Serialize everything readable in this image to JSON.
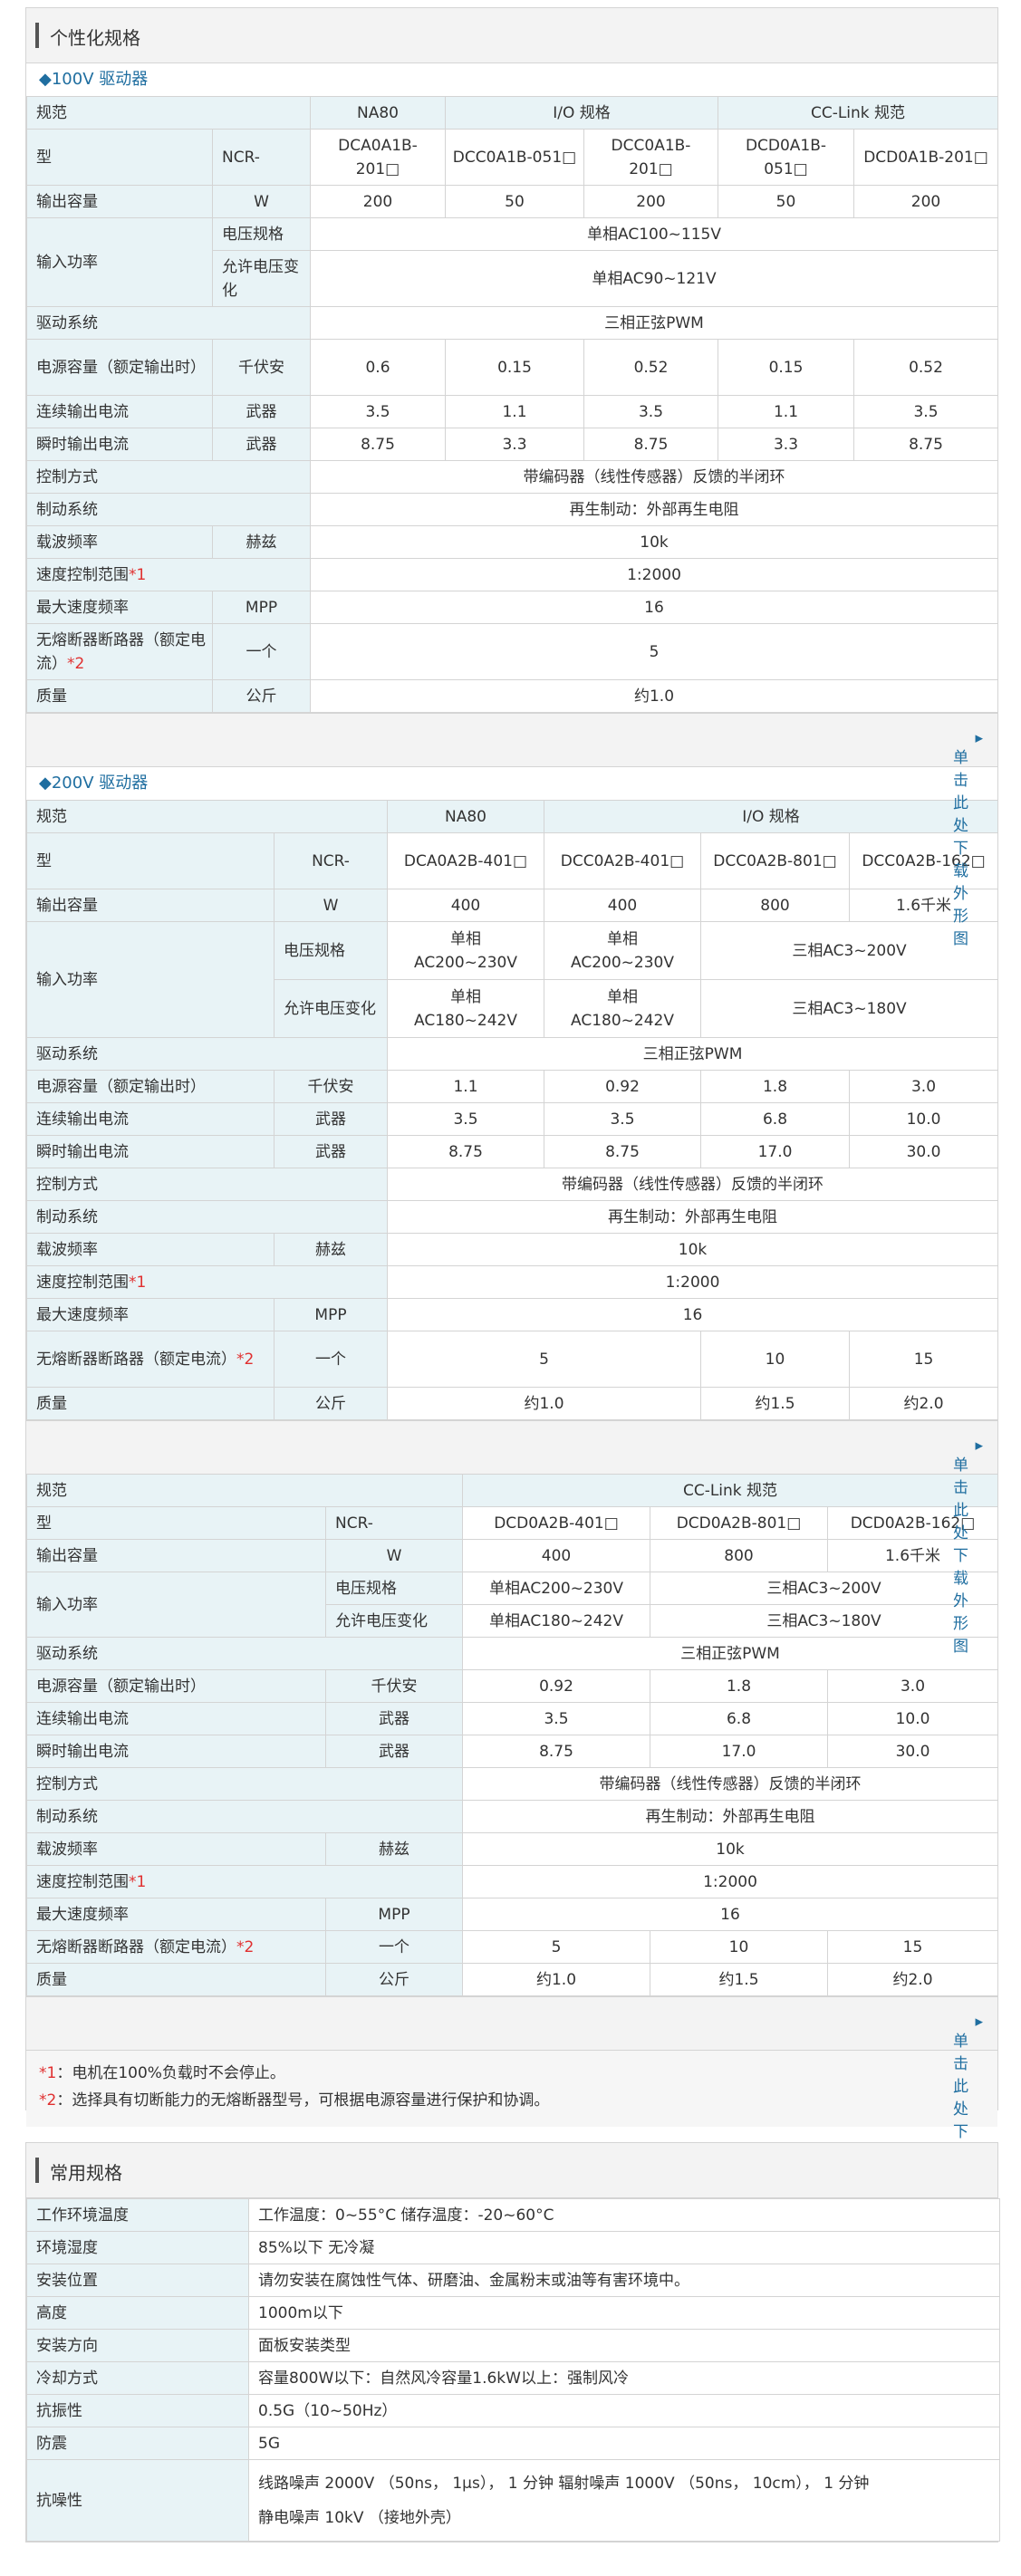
{
  "personal": {
    "title": "个性化规格",
    "d100": {
      "sub": "◆100V 驱动器",
      "spec": "规范",
      "na80": "NA80",
      "io": "I/O 规格",
      "cc": "CC-Link 规范",
      "model": "型",
      "ncr": "NCR-",
      "models": [
        "DCA0A1B-201□",
        "DCC0A1B-051□",
        "DCC0A1B-201□",
        "DCD0A1B-051□",
        "DCD0A1B-201□"
      ],
      "out_cap": "输出容量",
      "w": "W",
      "out_vals": [
        "200",
        "50",
        "200",
        "50",
        "200"
      ],
      "input": "输入功率",
      "v_spec": "电压规格",
      "v_spec_val": "单相AC100~115V",
      "v_allow": "允许电压变化",
      "v_allow_val": "单相AC90~121V",
      "drive": "驱动系统",
      "drive_val": "三相正弦PWM",
      "pcap": "电源容量（额定输出时）",
      "kva": "千伏安",
      "pcap_vals": [
        "0.6",
        "0.15",
        "0.52",
        "0.15",
        "0.52"
      ],
      "cont": "连续输出电流",
      "wq": "武器",
      "cont_vals": [
        "3.5",
        "1.1",
        "3.5",
        "1.1",
        "3.5"
      ],
      "inst": "瞬时输出电流",
      "inst_vals": [
        "8.75",
        "3.3",
        "8.75",
        "3.3",
        "8.75"
      ],
      "ctrl": "控制方式",
      "ctrl_val": "带编码器（线性传感器）反馈的半闭环",
      "brake": "制动系统",
      "brake_val": "再生制动：外部再生电阻",
      "carrier": "载波频率",
      "hz": "赫兹",
      "carrier_val": "10k",
      "speed": "速度控制范围",
      "mark1": "*1",
      "speed_val": "1:2000",
      "maxf": "最大速度频率",
      "mpp": "MPP",
      "maxf_val": "16",
      "nfb": "无熔断器断路器（额定电流）",
      "mark2": "*2",
      "one": "一个",
      "nfb_val": "5",
      "mass": "质量",
      "kg": "公斤",
      "mass_val": "约1.0",
      "download": "单击此处下载外形图"
    },
    "d200": {
      "sub": "◆200V 驱动器",
      "spec": "规范",
      "na80": "NA80",
      "io": "I/O 规格",
      "model": "型",
      "ncr": "NCR-",
      "models": [
        "DCA0A2B-401□",
        "DCC0A2B-401□",
        "DCC0A2B-801□",
        "DCC0A2B-162□"
      ],
      "out_cap": "输出容量",
      "w": "W",
      "out_vals": [
        "400",
        "400",
        "800",
        "1.6千米"
      ],
      "input": "输入功率",
      "v_spec": "电压规格",
      "v_allow": "允许电压变化",
      "v_spec_vals": [
        "单相\nAC200~230V",
        "单相\nAC200~230V",
        "三相AC3~200V"
      ],
      "v_allow_vals": [
        "单相\nAC180~242V",
        "单相\nAC180~242V",
        "三相AC3~180V"
      ],
      "drive": "驱动系统",
      "drive_val": "三相正弦PWM",
      "pcap": "电源容量（额定输出时）",
      "kva": "千伏安",
      "pcap_vals": [
        "1.1",
        "0.92",
        "1.8",
        "3.0"
      ],
      "cont": "连续输出电流",
      "wq": "武器",
      "cont_vals": [
        "3.5",
        "3.5",
        "6.8",
        "10.0"
      ],
      "inst": "瞬时输出电流",
      "inst_vals": [
        "8.75",
        "8.75",
        "17.0",
        "30.0"
      ],
      "ctrl": "控制方式",
      "ctrl_val": "带编码器（线性传感器）反馈的半闭环",
      "brake": "制动系统",
      "brake_val": "再生制动：外部再生电阻",
      "carrier": "载波频率",
      "hz": "赫兹",
      "carrier_val": "10k",
      "speed": "速度控制范围",
      "mark1": "*1",
      "speed_val": "1:2000",
      "maxf": "最大速度频率",
      "mpp": "MPP",
      "maxf_val": "16",
      "nfb": "无熔断器断路器（额定电流）",
      "mark2": "*2",
      "one": "一个",
      "nfb_vals": [
        "5",
        "10",
        "15"
      ],
      "mass": "质量",
      "kg": "公斤",
      "mass_vals": [
        "约1.0",
        "约1.5",
        "约2.0"
      ],
      "download": "单击此处下载外形图"
    },
    "cc200": {
      "spec": "规范",
      "cc": "CC-Link 规范",
      "model": "型",
      "ncr": "NCR-",
      "models": [
        "DCD0A2B-401□",
        "DCD0A2B-801□",
        "DCD0A2B-162□"
      ],
      "out_cap": "输出容量",
      "w": "W",
      "out_vals": [
        "400",
        "800",
        "1.6千米"
      ],
      "input": "输入功率",
      "v_spec": "电压规格",
      "v_allow": "允许电压变化",
      "v_spec_vals": [
        "单相AC200~230V",
        "三相AC3~200V"
      ],
      "v_allow_vals": [
        "单相AC180~242V",
        "三相AC3~180V"
      ],
      "drive": "驱动系统",
      "drive_val": "三相正弦PWM",
      "pcap": "电源容量（额定输出时）",
      "kva": "千伏安",
      "pcap_vals": [
        "0.92",
        "1.8",
        "3.0"
      ],
      "cont": "连续输出电流",
      "wq": "武器",
      "cont_vals": [
        "3.5",
        "6.8",
        "10.0"
      ],
      "inst": "瞬时输出电流",
      "inst_vals": [
        "8.75",
        "17.0",
        "30.0"
      ],
      "ctrl": "控制方式",
      "ctrl_val": "带编码器（线性传感器）反馈的半闭环",
      "brake": "制动系统",
      "brake_val": "再生制动：外部再生电阻",
      "carrier": "载波频率",
      "hz": "赫兹",
      "carrier_val": "10k",
      "speed": "速度控制范围",
      "mark1": "*1",
      "speed_val": "1:2000",
      "maxf": "最大速度频率",
      "mpp": "MPP",
      "maxf_val": "16",
      "nfb": "无熔断器断路器（额定电流）",
      "mark2": "*2",
      "one": "一个",
      "nfb_vals": [
        "5",
        "10",
        "15"
      ],
      "mass": "质量",
      "kg": "公斤",
      "mass_vals": [
        "约1.0",
        "约1.5",
        "约2.0"
      ],
      "download": "单击此处下载外形图"
    },
    "notes": [
      {
        "mark": "*1",
        "text": "：电机在100%负载时不会停止。"
      },
      {
        "mark": "*2",
        "text": "：选择具有切断能力的无熔断器型号，可根据电源容量进行保护和协调。"
      }
    ]
  },
  "general": {
    "title": "常用规格",
    "rows": [
      {
        "label": "工作环境温度",
        "value": "工作温度：0~55°C 储存温度：-20~60°C"
      },
      {
        "label": "环境湿度",
        "value": "85%以下 无冷凝"
      },
      {
        "label": "安装位置",
        "value": "请勿安装在腐蚀性气体、研磨油、金属粉末或油等有害环境中。"
      },
      {
        "label": "高度",
        "value": "1000m以下"
      },
      {
        "label": "安装方向",
        "value": "面板安装类型"
      },
      {
        "label": "冷却方式",
        "value": "容量800W以下：自然风冷容量1.6kW以上：强制风冷"
      },
      {
        "label": "抗振性",
        "value": "0.5G（10~50Hz）"
      },
      {
        "label": "防震",
        "value": "5G"
      }
    ],
    "noise_label": "抗噪性",
    "noise_line1": "线路噪声 2000V （50ns， 1μs）， 1 分钟 辐射噪声 1000V （50ns， 10cm）， 1 分钟",
    "noise_line2": "静电噪声 10kV （接地外壳）"
  }
}
